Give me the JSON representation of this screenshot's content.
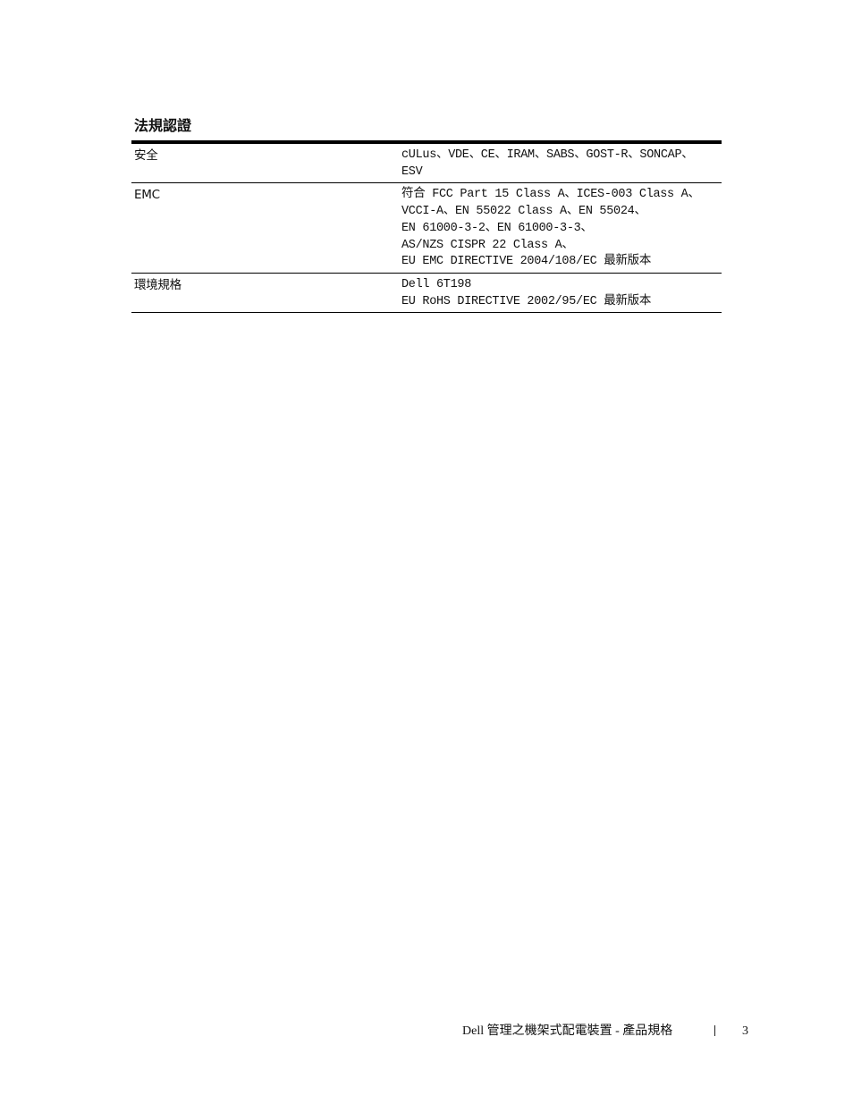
{
  "section": {
    "title": "法規認證"
  },
  "table": {
    "rows": [
      {
        "label": "安全",
        "lines": [
          "cULus、VDE、CE、IRAM、SABS、GOST-R、SONCAP、",
          "ESV"
        ]
      },
      {
        "label": "EMC",
        "lines": [
          "符合 FCC Part 15 Class A、ICES-003 Class A、",
          "VCCI-A、EN 55022 Class A、EN 55024、",
          "EN 61000-3-2、EN 61000-3-3、",
          "AS/NZS CISPR 22 Class A、",
          "EU EMC DIRECTIVE 2004/108/EC 最新版本"
        ]
      },
      {
        "label": "環境規格",
        "lines": [
          "Dell 6T198",
          "EU RoHS DIRECTIVE 2002/95/EC 最新版本"
        ]
      }
    ]
  },
  "footer": {
    "doc_title": "Dell 管理之機架式配電裝置 - 產品規格",
    "page_number": "3"
  }
}
